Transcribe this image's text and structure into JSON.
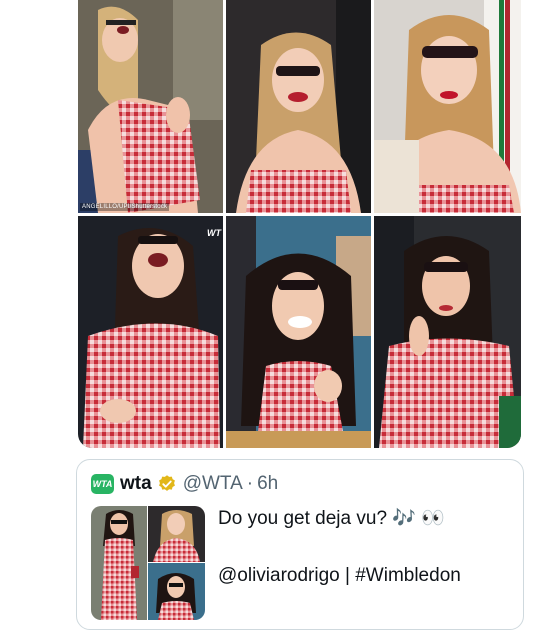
{
  "photo_grid": {
    "watermark": "ANGELILLO/UPI/Shutterstock",
    "corner_mark": "WT",
    "tiles": [
      "taylor-laughing-head-back",
      "taylor-sunglasses-smiling",
      "taylor-sunglasses-red-lips",
      "olivia-laughing-head-back",
      "olivia-smiling-clapping",
      "olivia-sunglasses-clapping"
    ]
  },
  "quoted_post": {
    "logo_text": "WTA",
    "display_name": "wta",
    "handle": "@WTA",
    "separator": "·",
    "time": "6h",
    "text_line1": "Do you get deja vu? 🎶 👀",
    "text_line2": "@oliviarodrigo | #Wimbledon",
    "verified_badge_color": "#e2b719"
  },
  "colors": {
    "accent_green": "#28b463",
    "gingham_red": "#d9404a",
    "border": "#cfd9de"
  }
}
